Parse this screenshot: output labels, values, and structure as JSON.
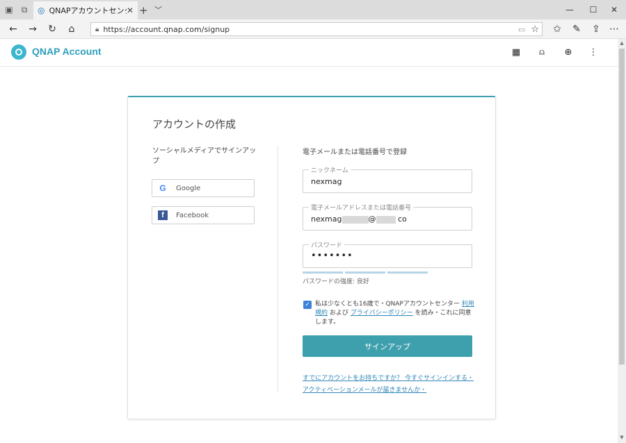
{
  "browser": {
    "tab_title": "QNAPアカウントセンター",
    "url": "https://account.qnap.com/signup"
  },
  "header": {
    "brand": "QNAP Account"
  },
  "card": {
    "title": "アカウントの作成",
    "social": {
      "heading": "ソーシャルメディアでサインアップ",
      "google_label": "Google",
      "facebook_label": "Facebook"
    },
    "form": {
      "heading": "電子メールまたは電話番号で登録",
      "nickname_label": "ニックネーム",
      "nickname_value": "nexmag",
      "email_label": "電子メールアドレスまたは電話番号",
      "email_part1": "nexmag",
      "email_part2": "@",
      "email_part3": "co",
      "password_label": "パスワード",
      "password_value": "•••••••",
      "strength_text": "パスワードの強度: 良好",
      "terms_text_1": "私は少なくとも16歳で・QNAPアカウントセンター ",
      "terms_link_1": "利用規約",
      "terms_text_2": " および ",
      "terms_link_2": "プライバシーポリシー",
      "terms_text_3": " を読み・これに同意します。",
      "submit_label": "サインアップ",
      "signin_link": "すでにアカウントをお持ちですか？ 今すぐサインインする・",
      "activation_link": "アクティベーションメールが届きませんか・"
    }
  }
}
